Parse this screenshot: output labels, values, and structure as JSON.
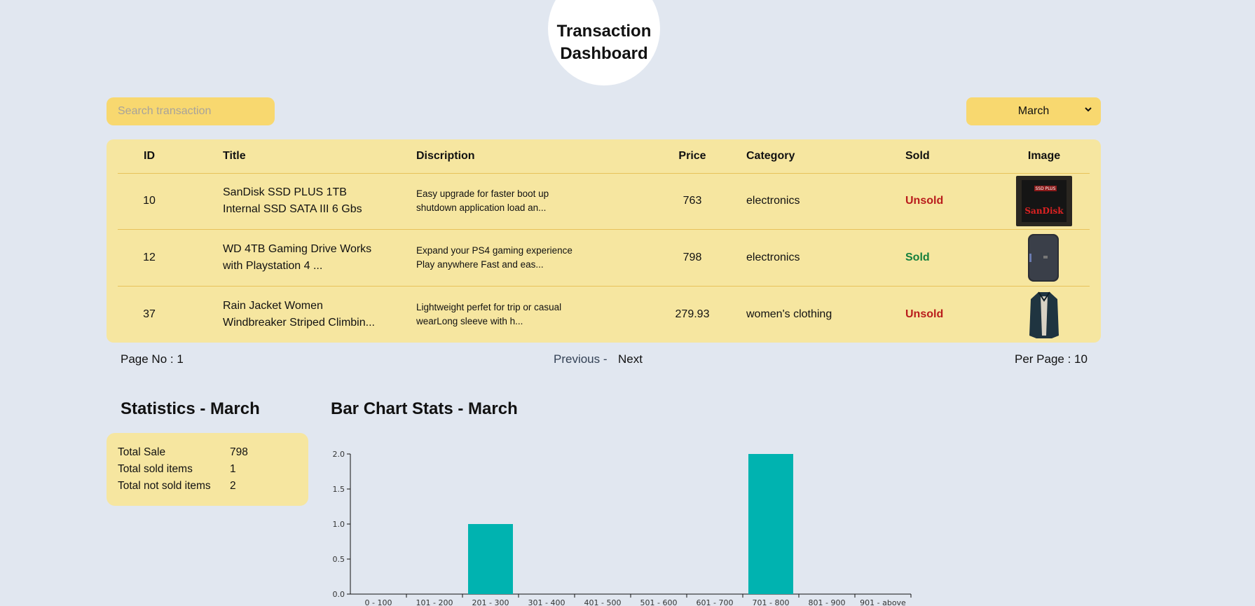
{
  "header": {
    "title_line1": "Transaction",
    "title_line2": "Dashboard"
  },
  "search": {
    "placeholder": "Search transaction",
    "value": ""
  },
  "month_select": {
    "selected": "March",
    "chevron_icon": "chevron-down-icon"
  },
  "table": {
    "headers": [
      "ID",
      "Title",
      "Discription",
      "Price",
      "Category",
      "Sold",
      "Image"
    ],
    "rows": [
      {
        "id": "10",
        "title": "SanDisk SSD PLUS 1TB Internal SSD SATA III 6 Gbs",
        "description_l1": "Easy upgrade for faster boot up",
        "description_l2": "shutdown application load an...",
        "price": "763",
        "category": "electronics",
        "sold": "Unsold",
        "image": "ssd-image"
      },
      {
        "id": "12",
        "title": "WD 4TB Gaming Drive Works with Playstation 4 ...",
        "description_l1": "Expand your PS4 gaming experience",
        "description_l2": "Play anywhere Fast and eas...",
        "price": "798",
        "category": "electronics",
        "sold": "Sold",
        "image": "hard-drive-image"
      },
      {
        "id": "37",
        "title": "Rain Jacket Women Windbreaker Striped Climbin...",
        "description_l1": "Lightweight perfet for trip or casual",
        "description_l2": "wearLong sleeve with h...",
        "price": "279.93",
        "category": "women's clothing",
        "sold": "Unsold",
        "image": "jacket-image"
      }
    ]
  },
  "pagination": {
    "page_no": "Page No : 1",
    "previous": "Previous -",
    "next": "Next",
    "per_page": "Per Page : 10"
  },
  "statistics": {
    "title": "Statistics - March",
    "items": [
      {
        "label": "Total Sale",
        "value": "798"
      },
      {
        "label": "Total sold items",
        "value": "1"
      },
      {
        "label": "Total not sold items",
        "value": "2"
      }
    ]
  },
  "bar_chart": {
    "title": "Bar Chart Stats - March"
  },
  "chart_data": {
    "type": "bar",
    "title": "",
    "xlabel": "",
    "ylabel": "",
    "categories": [
      "0 - 100",
      "101 - 200",
      "201 - 300",
      "301 - 400",
      "401 - 500",
      "501 - 600",
      "601 - 700",
      "701 - 800",
      "801 - 900",
      "901 - above"
    ],
    "values": [
      0,
      0,
      1,
      0,
      0,
      0,
      0,
      2,
      0,
      0
    ],
    "ylim": [
      0,
      2
    ],
    "yticks": [
      "0.0",
      "0.5",
      "1.0",
      "1.5",
      "2.0"
    ],
    "color": "#00b3b0"
  },
  "colors": {
    "background": "#e1e7f0",
    "accent": "#f8d86f",
    "card": "#f6e6a0",
    "unsold": "#b91c1c",
    "sold": "#15803d"
  }
}
